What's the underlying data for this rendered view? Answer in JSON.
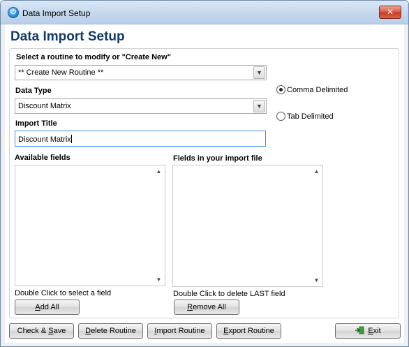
{
  "window": {
    "title": "Data Import Setup",
    "close_glyph": "✕",
    "app_icon": "power-icon"
  },
  "heading": "Data Import Setup",
  "routine": {
    "label": "Select a routine to modify or \"Create New\"",
    "selected": "** Create New Routine **"
  },
  "data_type": {
    "label": "Data Type",
    "selected": "Discount Matrix"
  },
  "import_title": {
    "label": "Import Title",
    "value": "Discount Matrix"
  },
  "delimiter": {
    "options": [
      {
        "label": "Comma Delimited",
        "checked": true
      },
      {
        "label": "Tab Delimited",
        "checked": false
      }
    ]
  },
  "available_fields": {
    "label": "Available fields",
    "items": [],
    "hint": "Double Click to select a field",
    "button": {
      "prefix": "",
      "underlined": "A",
      "suffix": "dd All"
    }
  },
  "import_fields": {
    "label": "Fields in your import file",
    "items": [],
    "hint": "Double Click to delete LAST field",
    "button": {
      "prefix": "",
      "underlined": "R",
      "suffix": "emove All"
    }
  },
  "footer_buttons": {
    "check_save": {
      "prefix": "Check & ",
      "underlined": "S",
      "suffix": "ave"
    },
    "delete_routine": {
      "prefix": "",
      "underlined": "D",
      "suffix": "elete Routine"
    },
    "import_routine": {
      "prefix": "",
      "underlined": "I",
      "suffix": "mport Routine"
    },
    "export_routine": {
      "prefix": "",
      "underlined": "E",
      "suffix": "xport Routine"
    },
    "exit": {
      "prefix": "",
      "underlined": "E",
      "suffix": "xit",
      "icon": "exit-door-icon"
    }
  },
  "colors": {
    "heading": "#123a6c",
    "focus_border": "#3d8ee6",
    "close_button": "#c23b22"
  }
}
